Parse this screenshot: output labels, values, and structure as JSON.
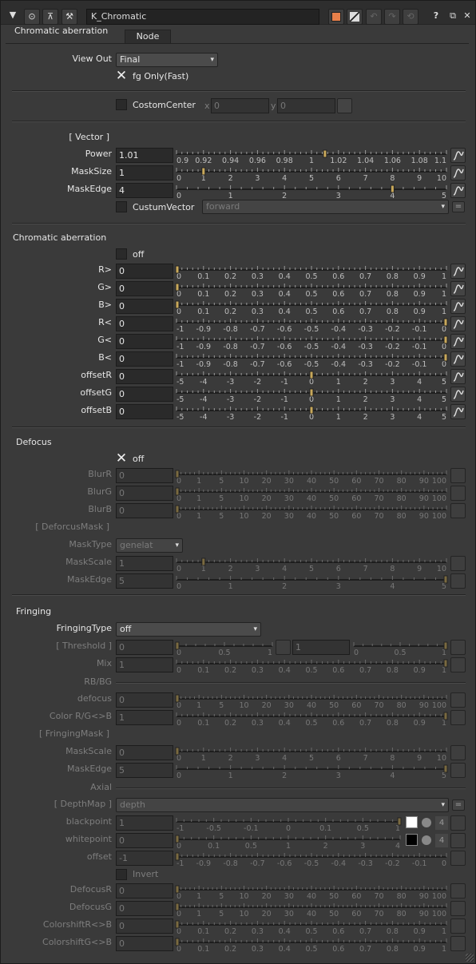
{
  "toolbar": {
    "node_name": "K_Chromatic",
    "help": "?"
  },
  "tabs": [
    "Chromatic aberration",
    "Node"
  ],
  "view_out": {
    "label": "View Out",
    "value": "Final",
    "fg_only_label": "fg Only(Fast)",
    "fg_only_checked": true
  },
  "custom_center": {
    "label": "CostomCenter",
    "x_prefix": "x",
    "x_value": "0",
    "y_prefix": "y",
    "y_value": "0"
  },
  "vector": {
    "header": "[ Vector ]",
    "power": {
      "label": "Power",
      "value": "1.01"
    },
    "mask_size": {
      "label": "MaskSize",
      "value": "1"
    },
    "mask_edge": {
      "label": "MaskEdge",
      "value": "4"
    },
    "custum_vector": {
      "label": "CustumVector",
      "value": "forward"
    }
  },
  "chromatic": {
    "header": "Chromatic aberration",
    "off_label": "off",
    "params": [
      {
        "label": "R>",
        "value": "0"
      },
      {
        "label": "G>",
        "value": "0"
      },
      {
        "label": "B>",
        "value": "0"
      },
      {
        "label": "R<",
        "value": "0"
      },
      {
        "label": "G<",
        "value": "0"
      },
      {
        "label": "B<",
        "value": "0"
      },
      {
        "label": "offsetR",
        "value": "0"
      },
      {
        "label": "offsetG",
        "value": "0"
      },
      {
        "label": "offsetB",
        "value": "0"
      }
    ]
  },
  "defocus": {
    "header": "Defocus",
    "off_label": "off",
    "off_checked": true,
    "blur": [
      {
        "label": "BlurR",
        "value": "0"
      },
      {
        "label": "BlurG",
        "value": "0"
      },
      {
        "label": "BlurB",
        "value": "0"
      }
    ],
    "mask_header": "[ DeforcusMask ]",
    "mask_type": {
      "label": "MaskType",
      "value": "genelat"
    },
    "mask_scale": {
      "label": "MaskScale",
      "value": "1"
    },
    "mask_edge": {
      "label": "MaskEdge",
      "value": "5"
    }
  },
  "fringing": {
    "header": "Fringing",
    "type": {
      "label": "FringingType",
      "value": "off"
    },
    "threshold": {
      "label": "[ Threshold ]",
      "value_a": "0",
      "value_b": "1"
    },
    "mix": {
      "label": "Mix",
      "value": "1"
    },
    "rbbg_header": "RB/BG",
    "defocus": {
      "label": "defocus",
      "value": "0"
    },
    "color_rg_b": {
      "label": "Color R/G<>B",
      "value": "1"
    },
    "mask_header": "[ FringingMask ]",
    "mask_scale": {
      "label": "MaskScale",
      "value": "0"
    },
    "mask_edge": {
      "label": "MaskEdge",
      "value": "5"
    },
    "axial_header": "Axial",
    "depth_map": {
      "label": "[ DepthMap ]",
      "value": "depth"
    },
    "blackpoint": {
      "label": "blackpoint",
      "value": "1",
      "channel": "4"
    },
    "whitepoint": {
      "label": "whitepoint",
      "value": "0",
      "channel": "4"
    },
    "offset": {
      "label": "offset",
      "value": "-1"
    },
    "invert_label": "Invert",
    "defocus_r": {
      "label": "DefocusR",
      "value": "0"
    },
    "defocus_g": {
      "label": "DefocusG",
      "value": "0"
    },
    "colorshift_r": {
      "label": "ColorshiftR<>B",
      "value": "0"
    },
    "colorshift_g": {
      "label": "ColorshiftG<>B",
      "value": "0"
    }
  },
  "scales": {
    "power": [
      "0.9",
      "0.92",
      "0.94",
      "0.96",
      "0.98",
      "1",
      "1.02",
      "1.04",
      "1.06",
      "1.08",
      "1.1"
    ],
    "ten": [
      "0",
      "1",
      "2",
      "3",
      "4",
      "5",
      "6",
      "7",
      "8",
      "9",
      "10"
    ],
    "five": [
      "0",
      "1",
      "2",
      "3",
      "4",
      "5"
    ],
    "unit": [
      "0",
      "0.1",
      "0.2",
      "0.3",
      "0.4",
      "0.5",
      "0.6",
      "0.7",
      "0.8",
      "0.9",
      "1"
    ],
    "neg": [
      "-1",
      "-0.9",
      "-0.8",
      "-0.7",
      "-0.6",
      "-0.5",
      "-0.4",
      "-0.3",
      "-0.2",
      "-0.1",
      "0"
    ],
    "offset": [
      "-5",
      "-4",
      "-3",
      "-2",
      "-1",
      "0",
      "1",
      "2",
      "3",
      "4",
      "5"
    ],
    "blur": [
      "0",
      "1",
      "5",
      "10",
      "20",
      "30",
      "40",
      "50",
      "60",
      "70",
      "80",
      "90",
      "100"
    ],
    "half": [
      "0",
      "0.5",
      "1"
    ],
    "black": [
      "-1",
      "-0.5",
      "-0.1",
      "0",
      "0.1",
      "0.5",
      "1"
    ],
    "white": [
      "0",
      "0.1",
      "0.5",
      "1",
      "2",
      "3",
      "4"
    ]
  },
  "slider_levels": {
    "power": 0.55,
    "mask_size": 0.1,
    "mask_edge": 0.8,
    "chroma": [
      0,
      0,
      0,
      1,
      1,
      1,
      0.5,
      0.5,
      0.5
    ],
    "zero": 0,
    "fr_mask_edge": 1,
    "offset": 0
  },
  "colors": {
    "panel_bg": "#3a3a3a",
    "field_bg": "#2a2a2a",
    "accent": "#e8804a",
    "handle": "#c8a85a"
  }
}
